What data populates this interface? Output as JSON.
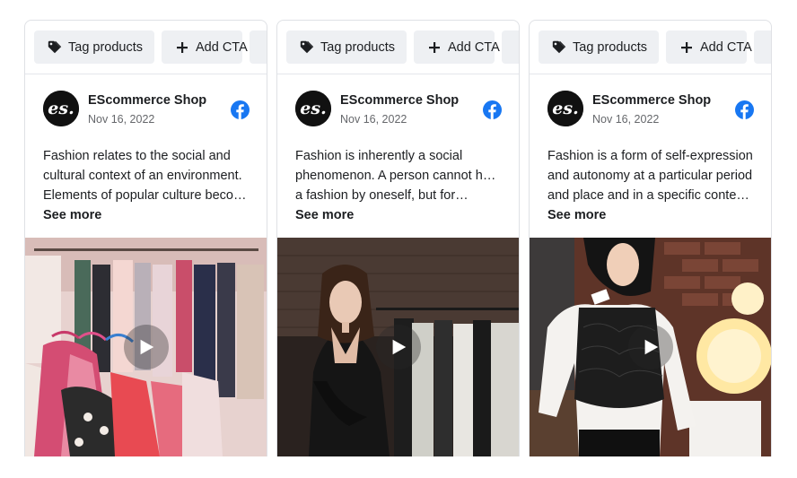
{
  "toolbar": {
    "tag_label": "Tag products",
    "cta_label": "Add CTA"
  },
  "posts": [
    {
      "shop_name": "EScommerce Shop",
      "date": "Nov 16, 2022",
      "text_lines": [
        "Fashion relates to the social and",
        "cultural context of an environment.",
        "Elements of popular culture becom…"
      ],
      "see_more": "See more",
      "media_subject": "clothing rack with colorful hangers"
    },
    {
      "shop_name": "EScommerce Shop",
      "date": "Nov 16, 2022",
      "text_lines": [
        "Fashion is inherently a social",
        "phenomenon. A person cannot have",
        "a fashion by oneself, but for…"
      ],
      "see_more": "See more",
      "media_subject": "woman in leather jacket in clothing store"
    },
    {
      "shop_name": "EScommerce Shop",
      "date": "Nov 16, 2022",
      "text_lines": [
        "Fashion is a form of self-expression",
        "and autonomy at a particular period",
        "and place and in a specific context,…"
      ],
      "see_more": "See more",
      "media_subject": "woman holding black lace top"
    }
  ],
  "icons": {
    "tag": "tag-icon",
    "add": "plus-icon",
    "network": "facebook-icon",
    "play": "play-icon"
  },
  "colors": {
    "facebook": "#1877f2",
    "button_bg": "#eef0f3",
    "avatar_bg": "#111111"
  }
}
